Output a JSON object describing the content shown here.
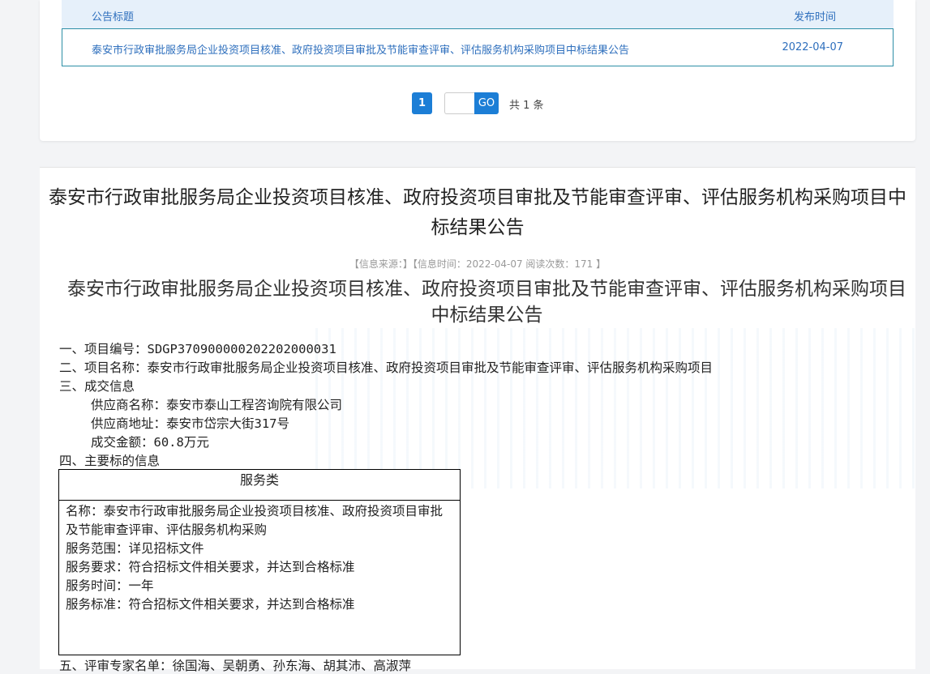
{
  "list": {
    "col_title": "公告标题",
    "col_date": "发布时间",
    "rows": [
      {
        "title": "泰安市行政审批服务局企业投资项目核准、政府投资项目审批及节能审查评审、评估服务机构采购项目中标结果公告",
        "date": "2022-04-07"
      }
    ]
  },
  "pager": {
    "current": "1",
    "go_label": "GO",
    "input_value": "",
    "total": "共 1 条"
  },
  "detail": {
    "title": "泰安市行政审批服务局企业投资项目核准、政府投资项目审批及节能审查评审、评估服务机构采购项目中标结果公告",
    "meta": "【信息来源：】【信息时间：2022-04-07  阅读次数：171 】",
    "body_title": "泰安市行政审批服务局企业投资项目核准、政府投资项目审批及节能审查评审、评估服务机构采购项目中标结果公告",
    "lines": {
      "item1": "一、项目编号：SDGP370900000202202000031",
      "item2": "二、项目名称：泰安市行政审批服务局企业投资项目核准、政府投资项目审批及节能审查评审、评估服务机构采购项目",
      "item3": "三、成交信息",
      "supplier_name": "供应商名称：泰安市泰山工程咨询院有限公司",
      "supplier_addr": "供应商地址：泰安市岱宗大街317号",
      "amount": "成交金额：60.8万元",
      "item4": "四、主要标的信息"
    },
    "table": {
      "header": "服务类",
      "name": "名称：泰安市行政审批服务局企业投资项目核准、政府投资项目审批及节能审查评审、评估服务机构采购",
      "scope": "服务范围：详见招标文件",
      "requirement": "服务要求：符合招标文件相关要求，并达到合格标准",
      "time": "服务时间：一年",
      "standard": "服务标准：符合招标文件相关要求，并达到合格标准"
    },
    "next_line": "五、评审专家名单：徐国海、吴朝勇、孙东海、胡其沛、高淑萍"
  }
}
